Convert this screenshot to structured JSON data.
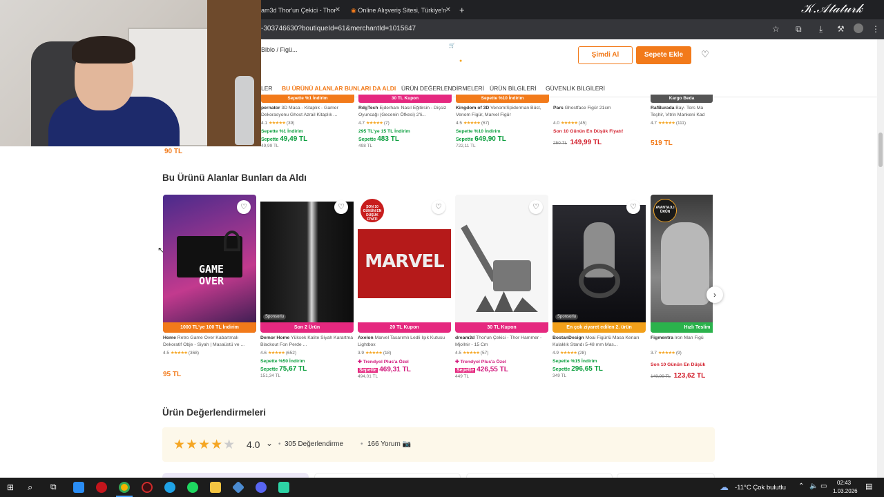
{
  "browser": {
    "tabs": [
      {
        "label": "am3d Thor'un Çekici - Thor"
      },
      {
        "label": "Online Alışveriş Sitesi, Türkiye'n"
      }
    ],
    "new_tab": "+",
    "url": "-303746630?boutiqueId=61&merchantId=1015647"
  },
  "overlay": {
    "signature": "K.Atatürk"
  },
  "header": {
    "breadcrumb": "Biblo / Figü...",
    "top_text_1": "",
    "buy_now": "Şimdi Al",
    "add_to_cart": "Sepete Ekle"
  },
  "subnav": {
    "items": [
      "LER",
      "BU ÜRÜNÜ ALANLAR BUNLARI DA ALDI",
      "ÜRÜN DEĞERLENDİRMELERİ",
      "ÜRÜN BİLGİLERİ",
      "GÜVENLİK BİLGİLERİ"
    ]
  },
  "top_products": [
    {
      "badge": "Sepette %1 İndirim",
      "badge_color": "#f27a1a",
      "brand": "pernator",
      "name": "3D Masa - Kitaplık - Gamer Dekorasyonu Ghost Azrail Kitaplık ...",
      "rating": "4.1",
      "count": "(39)",
      "promo": "Sepette %1 İndirim",
      "basket_label": "Sepette",
      "basket_price": "49,49 TL",
      "old": "49,99 TL"
    },
    {
      "badge": "30 TL Kupon",
      "badge_color": "#e5287f",
      "brand": "RdgTech",
      "name": "Ejderhanı Nasıl Eğitirsin - Dişsiz Oyuncağı (Gecenin Öfkesi) 2'li...",
      "rating": "4.7",
      "count": "(7)",
      "promo": "295 TL'ye 15 TL İndirim",
      "basket_label": "Sepette",
      "basket_price": "483 TL",
      "old": "498 TL"
    },
    {
      "badge": "Sepette %10 İndirim",
      "badge_color": "#f27a1a",
      "brand": "Kingdom of 3D",
      "name": "Venom/Spiderman Büst, Venom Figür, Marvel Figür",
      "rating": "4.5",
      "count": "(67)",
      "promo": "Sepette %10 İndirim",
      "basket_label": "Sepette",
      "basket_price": "649,90 TL",
      "old": "722,11 TL"
    },
    {
      "badge": "",
      "badge_color": "#ffffff",
      "brand": "Pars",
      "name": "Ghostface Figür 21cm",
      "rating": "4.0",
      "count": "(45)",
      "deal": "Son 10 Günün En Düşük Fiyatı!",
      "old_strike": "250 TL",
      "price": "149,99 TL"
    },
    {
      "badge": "Kargo Beda",
      "badge_color": "#555555",
      "brand": "RafBurada",
      "name": "Bay- Tors Ma Teşhir, Vitrin Mankeni Kad",
      "rating": "4.7",
      "count": "(111)",
      "price": "519 TL"
    }
  ],
  "partial_price": "90 TL",
  "section_title": "Bu Ürünü Alanlar Bunları da Aldı",
  "cards": [
    {
      "bar": "1000 TL'ye 100 TL İndirim",
      "bar_color": "#f27a1a",
      "brand": "Home",
      "name": "Retro Game Over Kabartmalı Dekoratif Obje - Siyah | Masaüstü ve ...",
      "rating": "4.5",
      "count": "(368)",
      "price": "95 TL",
      "img_text": "GAME OVER"
    },
    {
      "bar": "Son 2 Ürün",
      "bar_color": "#e5287f",
      "brand": "Demor Home",
      "name": "Yüksek Kalite Siyah Karartma Blackout Fon Perde ...",
      "rating": "4.6",
      "count": "(652)",
      "promo": "Sepette %50 İndirim",
      "basket_label": "Sepette",
      "basket_price": "75,67 TL",
      "old": "151,34 TL",
      "sponsored": "Sponsorlu"
    },
    {
      "bar": "20 TL Kupon",
      "bar_color": "#e5287f",
      "brand": "Axelon",
      "name": "Marvel Tasarımlı Ledli Işık Kutusu Lightbox",
      "rating": "3.9",
      "count": "(18)",
      "plus": "Trendyol Plus'a Özel",
      "basket_label": "Sepette",
      "basket_price": "469,31 TL",
      "old": "494,01 TL",
      "img_text": "MARVEL",
      "round_badge": "SON 10 GÜNÜN EN DÜŞÜK FİYATI"
    },
    {
      "bar": "30 TL Kupon",
      "bar_color": "#e5287f",
      "brand": "dream3d",
      "name": "Thor'un Çekici - Thor Hammer - Mjollnir - 15 Cm",
      "rating": "4.5",
      "count": "(57)",
      "plus": "Trendyol Plus'a Özel",
      "basket_label": "Sepette",
      "basket_price": "426,55 TL",
      "old": "449 TL"
    },
    {
      "bar": "En çok ziyaret edilen 2. ürün",
      "bar_color": "#f2a01a",
      "brand": "BostanDesign",
      "name": "Moai Figürlü Masa Kenarı Kulaklık Standı 5-48 mm Mas...",
      "rating": "4.9",
      "count": "(28)",
      "promo": "Sepette %15 İndirim",
      "basket_label": "Sepette",
      "basket_price": "296,65 TL",
      "old": "349 TL",
      "sponsored": "Sponsorlu"
    },
    {
      "bar": "Hızlı Teslim",
      "bar_color": "#2bb24c",
      "brand": "Figmentra",
      "name": "Iron Man Figü",
      "rating": "3.7",
      "count": "(9)",
      "deal": "Son 10 Günün En Düşük",
      "old_strike": "149,99 TL",
      "price": "123,62 TL",
      "round_badge": "AVANTAJLI ÜRÜN"
    }
  ],
  "reviews": {
    "title": "Ürün Değerlendirmeleri",
    "score": "4.0",
    "rating_value": 4.0,
    "count": "305 Değerlendirme",
    "comments": "166 Yorum"
  },
  "taskbar": {
    "weather": "-11°C  Çok bulutlu",
    "time": "02:43",
    "date": "1.03.2026"
  }
}
